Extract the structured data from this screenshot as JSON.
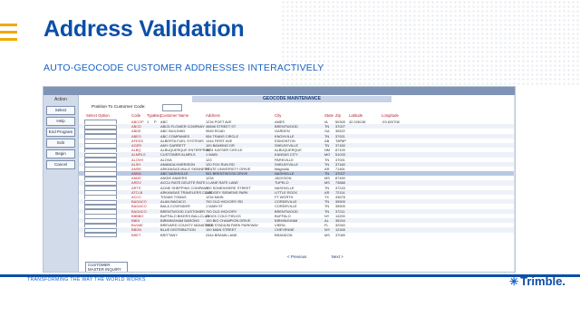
{
  "slide": {
    "title": "Address Validation",
    "subtitle": "AUTO-GEOCODE CUSTOMER ADDRESSES INTERACTIVELY",
    "tagline": "TRANSFORMING THE WAY THE WORLD WORKS",
    "logo": "Trimble.",
    "colors": {
      "title": "#0b4fa8",
      "accent": "#f2a900",
      "footer_line": "#0b4fa8"
    }
  },
  "app": {
    "side_header": "Action",
    "buttons": [
      "Select",
      "Help",
      "End Program",
      "Edit",
      "Begin",
      "Cancel"
    ],
    "window_header": "GEOCODE MAINTENANCE",
    "position_label": "Position To Customer Code:",
    "columns": [
      "Select Option",
      "Code",
      "Type",
      "Seq",
      "Customer Name",
      "Address",
      "City",
      "State",
      "Zip",
      "Latitude",
      "Longitude"
    ],
    "rows": [
      [
        "ABCOP",
        "P",
        "1",
        "ABC",
        "1234 POET AVE",
        "AMES",
        "IA",
        "50309",
        "42.026138",
        "-93.620708"
      ],
      [
        "ABCD",
        "",
        "",
        "ABCD FLOWER COMPANY",
        "45698 STREET ST",
        "BRENTWOOD",
        "TN",
        "37027",
        "",
        ""
      ],
      [
        "ABDE",
        "",
        "",
        "ABC BUILDING",
        "9545 ROAD",
        "GARDEN",
        "GA",
        "30522",
        "",
        ""
      ],
      [
        "ABEO",
        "",
        "",
        "ABC COMPANIES",
        "954 TRANS CIRCLE",
        "KNOXVILLE",
        "TN",
        "37921",
        "",
        ""
      ],
      [
        "AFEDS",
        "",
        "",
        "ALBERTA FUEL SYSTEMS",
        "1444 FIRST AVE",
        "EDMONTON",
        "AB",
        "T8P8P",
        "",
        ""
      ],
      [
        "AGER",
        "",
        "",
        "AMY GARRETT",
        "100 BANKING DR",
        "SHELBYVILLE",
        "TN",
        "37160",
        "",
        ""
      ],
      [
        "ALBQ",
        "",
        "",
        "ALBUQUERQUE ENTERPRISE",
        "3001 KAYSER CIRCLE",
        "ALBUQUERQUE",
        "NM",
        "87109",
        "",
        ""
      ],
      [
        "ALMRLS",
        "",
        "",
        "CUSTOMER ALMRLS",
        "1 MAIN",
        "KANSAS CITY",
        "MO",
        "51033",
        "",
        ""
      ],
      [
        "ALOVH",
        "",
        "",
        "ALOVA",
        "123",
        "PARKVILLE",
        "TN",
        "37001",
        "",
        ""
      ],
      [
        "ALSH",
        "",
        "",
        "AMANDA HARRISON",
        "120 FOX RUN RD",
        "SHELBYVILLE",
        "TN",
        "37160",
        "",
        ""
      ],
      [
        "AMSK",
        "",
        "",
        "ARKANSAS MULE SKINNERS",
        "STATE UNIVERSITY DRIVE",
        "Magnolia",
        "AR",
        "71461",
        "",
        ""
      ],
      [
        "ANNA",
        "",
        "",
        "ABC NASHVILLE",
        "951 BRENTWOOD DRIVE",
        "NASHVILLE",
        "TN",
        "37027",
        "",
        ""
      ],
      [
        "ANDE",
        "",
        "",
        "ANGIE ANDERS",
        "1234",
        "JACKSON",
        "MS",
        "87450",
        "",
        ""
      ],
      [
        "ARDV",
        "",
        "",
        "ACCU RATE DELETE RATE",
        "1 LANE RATE LANE",
        "TUPELO",
        "MS",
        "73868",
        "",
        ""
      ],
      [
        "ARTS",
        "",
        "",
        "ACME SHEPPING COMPANY",
        "300 SOMEWHERE STREET",
        "NASHVILLE",
        "TN",
        "37243",
        "",
        ""
      ],
      [
        "ATCLB",
        "",
        "",
        "ARKANSAS TRAVELERS CLUB",
        "DODGEY SIEMENS PARK",
        "LITTLE ROCK",
        "AR",
        "72114",
        "",
        ""
      ],
      [
        "ACCC",
        "",
        "",
        "TOMAS TOMAS",
        "1234 MAIN",
        "FT WORTH",
        "TX",
        "43678",
        "",
        ""
      ],
      [
        "BAGACO",
        "",
        "",
        "ALAN BAGACO",
        "700 OLD HICKORY RD",
        "CORDEVILLE",
        "TN",
        "39509",
        "",
        ""
      ],
      [
        "BAGACO",
        "",
        "",
        "BALA COVENDER",
        "1 MAIN ST",
        "CORDEVILLE",
        "TN",
        "39509",
        "",
        ""
      ],
      [
        "BAGACO",
        "",
        "",
        "BRENTWOOD CUSTOMER",
        "700 OLD HICKORY",
        "BRENTWOOD",
        "TN",
        "37211",
        "",
        ""
      ],
      [
        "BBBBO",
        "",
        "",
        "BUFFALO BIKERS BALLCLUB",
        "CHICK COLD FIELDS",
        "BUFFALO",
        "NY",
        "14200",
        "",
        ""
      ],
      [
        "BBDI",
        "",
        "",
        "BIRMINGHAM BARONS",
        "100 BIG CHAMPION DRIVE",
        "BIRMINGHAM",
        "AL",
        "35244",
        "",
        ""
      ],
      [
        "BUVAE",
        "",
        "",
        "BREVARD COUNTY MANATEES",
        "3000 STADIUM PARK PARKWAY",
        "VIERA",
        "FL",
        "32940",
        "",
        ""
      ],
      [
        "BBON",
        "",
        "",
        "BLUE DISTRIBUTION",
        "100 MAIN STREET",
        "CHEYENNE",
        "WY",
        "12345",
        "",
        ""
      ],
      [
        "BRET",
        "",
        "",
        "BRITTANY",
        "2444 BRANN LANE",
        "BRANDON",
        "MS",
        "37089",
        "",
        ""
      ]
    ],
    "popup_items": [
      "CUSTOMER MASTER INQUIRY",
      "MAINTAIN NAME",
      "REMOVE LAT LONG"
    ],
    "popup_highlight": 1,
    "pager": {
      "prev": "< Previous",
      "next": "Next >"
    }
  }
}
